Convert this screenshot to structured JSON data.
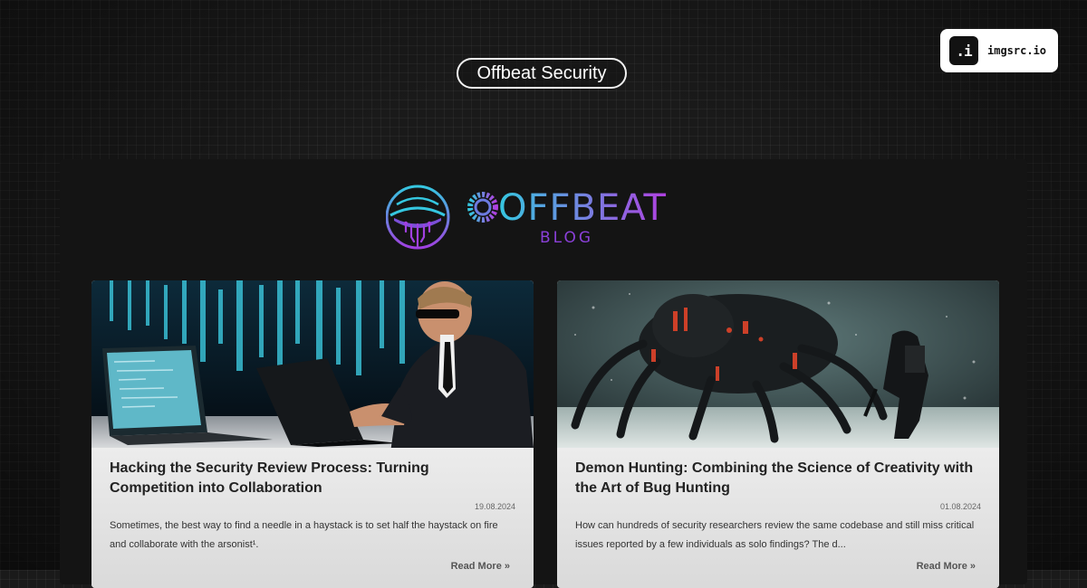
{
  "header": {
    "site_name": "Offbeat Security",
    "badge_icon_text": ".i",
    "badge_label": "imgsrc.io"
  },
  "logo": {
    "word": "OFFBEAT",
    "sub": "BLOG"
  },
  "colors": {
    "accent_cyan": "#35c7e0",
    "accent_purple": "#a040e0"
  },
  "posts": [
    {
      "title": "Hacking the Security Review Process: Turning Competition into Collaboration",
      "date": "19.08.2024",
      "excerpt": "Sometimes, the best way to find a needle in a haystack is to set half the haystack on fire and collaborate with the arsonist¹.",
      "read_more": "Read More »"
    },
    {
      "title": "Demon Hunting: Combining the Science of Creativity with the Art of Bug Hunting",
      "date": "01.08.2024",
      "excerpt": "How can hundreds of security researchers review the same codebase and still miss critical issues reported by a few individuals as solo findings? The d...",
      "read_more": "Read More »"
    }
  ]
}
